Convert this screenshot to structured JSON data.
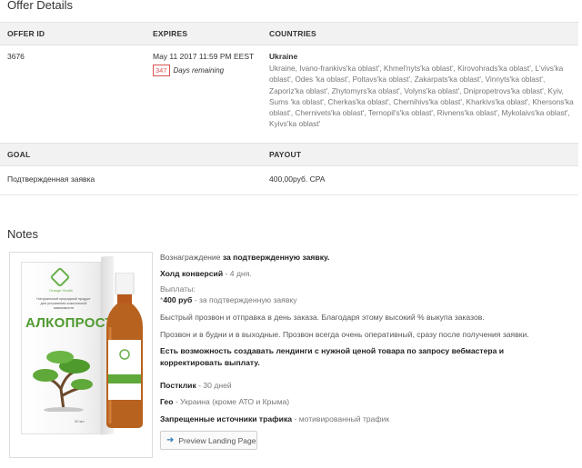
{
  "offer_details": {
    "title": "Offer Details",
    "headers": {
      "offer_id": "OFFER ID",
      "expires": "EXPIRES",
      "countries": "COUNTRIES"
    },
    "offer_id": "3676",
    "expires": "May 11 2017 11:59 PM EEST",
    "days_remaining_count": "347",
    "days_remaining_label": "Days remaining",
    "country": "Ukraine",
    "regions_lines": [
      "Ukraine, Ivano-frankivs'ka oblast', Khmel'nyts'ka oblast', Kirovohrads'ka oblast', L'vivs'ka",
      "oblast', Odes 'ka oblast', Poltavs'ka oblast', Zakarpats'ka oblast', Vinnyts'ka oblast',",
      "Zaporiz'ka oblast', Zhytomyrs'ka oblast', Volyns'ka oblast', Dnipropetrovs'ka oblast', Kyiv,",
      "Sums 'ka oblast', Cherkas'ka oblast', Chernihivs'ka oblast', Kharkivs'ka oblast', Khersons'ka",
      "oblast', Chernivets'ka oblast', Ternopil's'ka oblast', Rivnens'ka oblast', Mykolaivs'ka oblast',",
      "Kyivs'ka oblast'"
    ]
  },
  "goal_payout": {
    "headers": {
      "goal": "GOAL",
      "payout": "PAYOUT"
    },
    "goal": "Подтвержденная заявка",
    "payout": "400,00руб. CPA"
  },
  "notes": {
    "title": "Notes",
    "product_image": {
      "brand": "Orange Health",
      "box_description": "Натуральный природный продукт для устранения алкогольной зависимости",
      "product_name": "АЛКОПРОСТ",
      "volume": "30 мл"
    },
    "line1_prefix": "Вознаграждение ",
    "line1_bold": "за подтвержденную заявку.",
    "line2_bold": "Холд конверсий",
    "line2_rest": " - 4 дня.",
    "line3": "Выплаты:",
    "line4_star": "*",
    "line4_bold": "400 руб",
    "line4_rest": " - за подтвержденную заявку",
    "line5": "Быстрый прозвон и отправка в день заказа. Благодаря этому высокий % выкупа заказов.",
    "line6": "Прозвон и в будни и в выходные. Прозвон всегда очень оперативный, сразу после получения заявки.",
    "line7a": "Есть возможность создавать лендинги с нужной ценой товара по запросу вебмастера и",
    "line7b": "корректировать выплату.",
    "line8_bold": "Постклик",
    "line8_rest": " - 30 дней",
    "line9_bold": "Гео",
    "line9_rest": " - Украина (кроме АТО и Крыма)",
    "line10_bold": "Запрещенные источники трафика",
    "line10_rest": " - мотивированный трафик",
    "preview_button": "Preview Landing Page"
  },
  "colors": {
    "badge": "#d9534f",
    "header_bg": "#f2f2f2",
    "product_green": "#4f9a2f"
  }
}
